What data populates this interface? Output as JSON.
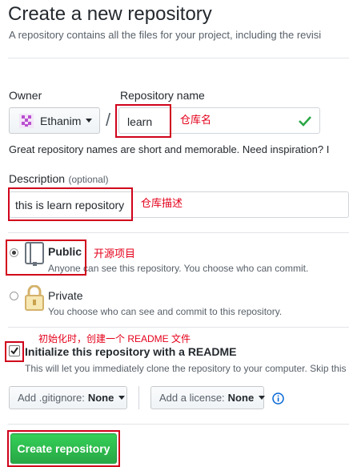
{
  "header": {
    "title": "Create a new repository",
    "subtitle": "A repository contains all the files for your project, including the revisi"
  },
  "owner": {
    "label": "Owner",
    "value": "Ethanim"
  },
  "repo": {
    "label": "Repository name",
    "value": "learn",
    "annotation": "仓库名",
    "status_icon": "check-icon"
  },
  "hint": "Great repository names are short and memorable. Need inspiration? I",
  "description": {
    "label": "Description",
    "optional": "(optional)",
    "value": "this is learn repository",
    "annotation": "仓库描述"
  },
  "visibility": {
    "public": {
      "title": "Public",
      "desc": "Anyone can see this repository. You choose who can commit.",
      "annotation": "开源项目",
      "selected": true
    },
    "private": {
      "title": "Private",
      "desc": "You choose who can see and commit to this repository.",
      "selected": false
    }
  },
  "readme": {
    "annotation": "初始化时，创建一个 README 文件",
    "label": "Initialize this repository with a README",
    "desc": "This will let you immediately clone the repository to your computer. Skip this",
    "checked": true
  },
  "gitignore": {
    "prefix": "Add .gitignore:",
    "value": "None"
  },
  "license": {
    "prefix": "Add a license:",
    "value": "None"
  },
  "submit": {
    "label": "Create repository"
  },
  "colors": {
    "annotation": "#d0021b",
    "primary_button": "#2cbe4e",
    "info_icon": "#0366d6",
    "check": "#28a745"
  }
}
